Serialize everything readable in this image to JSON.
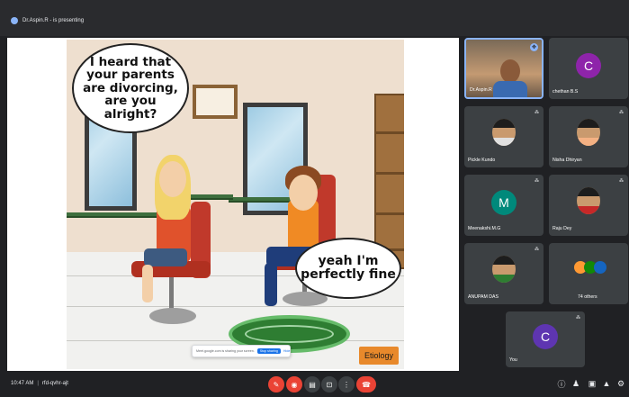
{
  "header": {
    "presenter_text": "Dr.Aspin.R - is presenting"
  },
  "slide": {
    "bubble_girl": "I heard that your parents are divorcing, are you alright?",
    "bubble_boy": "yeah I'm perfectly fine",
    "tag": "Etiology"
  },
  "share_bar": {
    "message": "Meet.google.com is sharing your screen.",
    "stop_label": "Stop sharing",
    "hide_label": "Hide"
  },
  "participants": [
    {
      "name": "Dr.Aspin.R",
      "kind": "video"
    },
    {
      "name": "chethan B.S",
      "kind": "letter",
      "letter": "C",
      "color": "#8e24aa"
    },
    {
      "name": "Pickle Kundo",
      "kind": "photo",
      "shirt": "#e0e0e0"
    },
    {
      "name": "Nisha Dhiryan",
      "kind": "photo",
      "shirt": "#f4b183"
    },
    {
      "name": "Meenakshi.M.G",
      "kind": "letter",
      "letter": "M",
      "color": "#00897b"
    },
    {
      "name": "Raju Dey",
      "kind": "photo",
      "shirt": "#c62828"
    },
    {
      "name": "ANUPAM DAS",
      "kind": "photo",
      "shirt": "#2e7d32"
    },
    {
      "name": "74 others",
      "kind": "group"
    },
    {
      "name": "You",
      "kind": "letter",
      "letter": "C",
      "color": "#5e35b1"
    }
  ],
  "footer": {
    "time": "10:47 AM",
    "meeting_code": "rfd-qvhr-ajt"
  },
  "icons": {
    "mic": "mic-off-icon",
    "cam": "camera-off-icon",
    "captions": "captions-icon",
    "present": "present-icon",
    "more": "more-icon",
    "hangup": "hang-up-icon"
  }
}
